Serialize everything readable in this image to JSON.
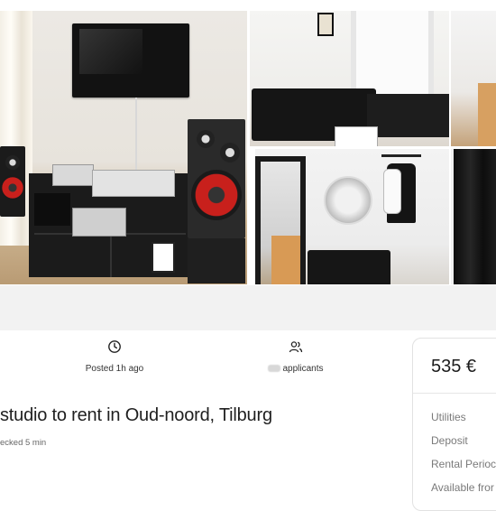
{
  "stats": {
    "posted": "Posted 1h ago",
    "applicants": "applicants"
  },
  "listing": {
    "title": "studio to rent in Oud-noord, Tilburg",
    "checked": "ecked 5 min"
  },
  "price_card": {
    "price": "535 €",
    "rows": [
      "Utilities",
      "Deposit",
      "Rental Perioc",
      "Available fror"
    ]
  },
  "icons": {
    "posted": "clock-icon",
    "applicants": "users-icon"
  },
  "colors": {
    "band": "#f2f2f2",
    "text": "#222222",
    "muted": "#7a7a7a"
  }
}
